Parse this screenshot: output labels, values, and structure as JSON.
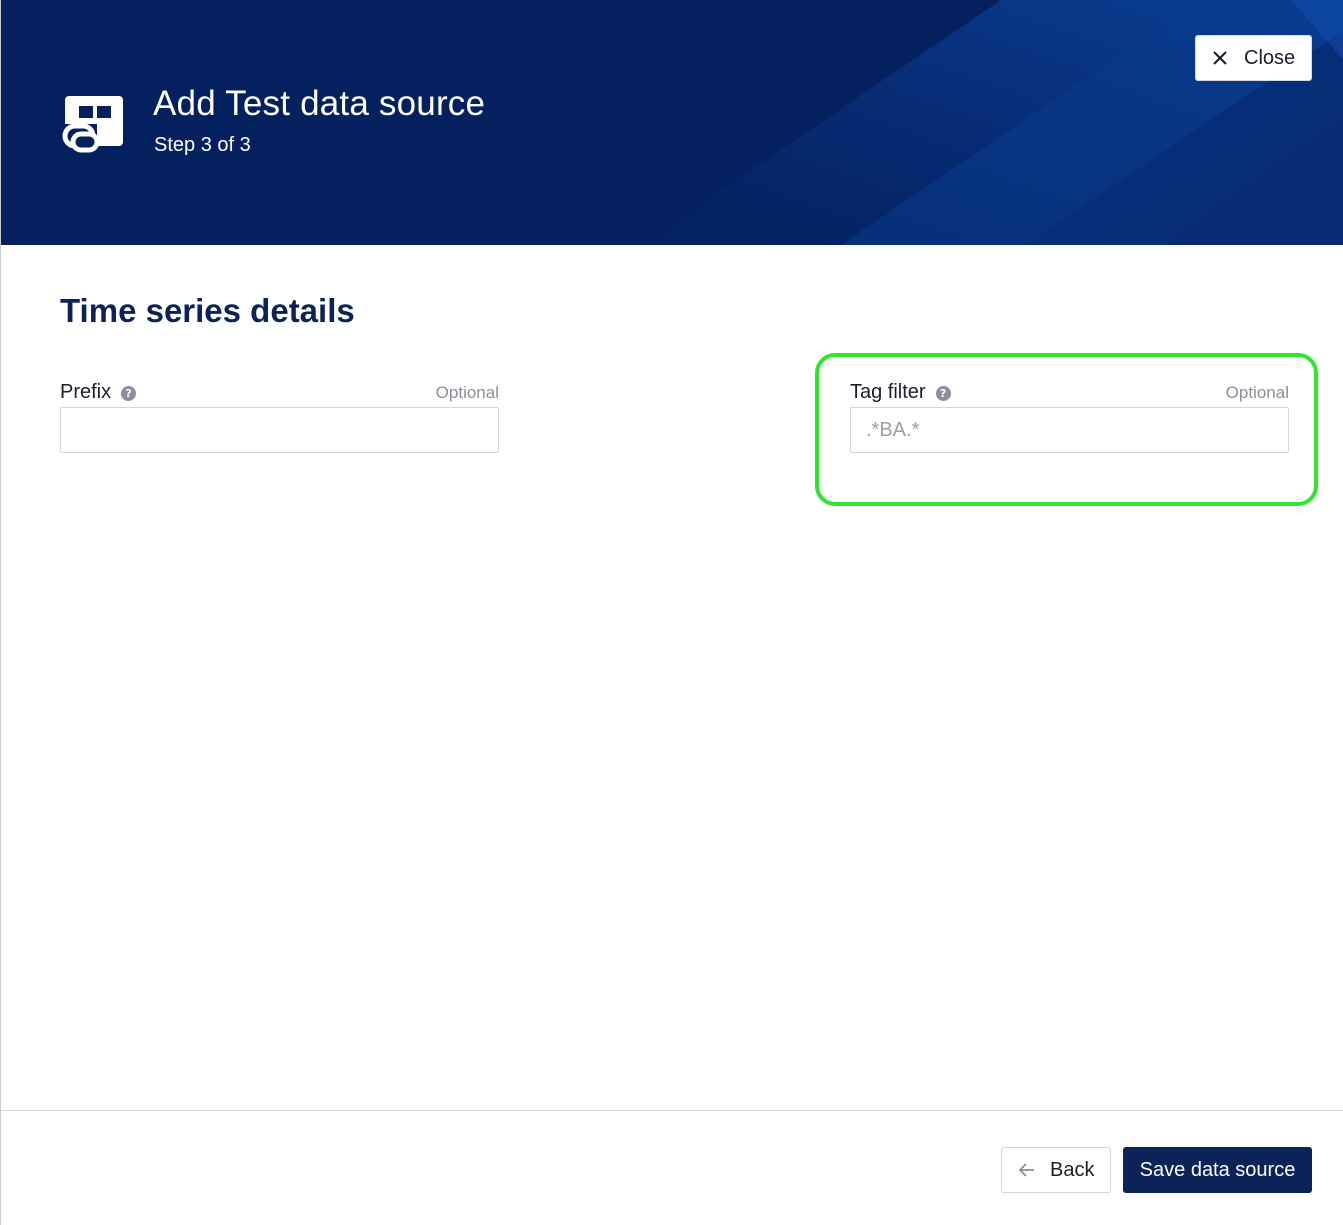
{
  "header": {
    "title": "Add Test data source",
    "step": "Step 3 of 3",
    "icon": "data-source-link-icon",
    "close_label": "Close",
    "background_color": "#04205f"
  },
  "section": {
    "title": "Time series details"
  },
  "fields": {
    "prefix": {
      "label": "Prefix",
      "optional": "Optional",
      "value": "",
      "placeholder": ""
    },
    "tag_filter": {
      "label": "Tag filter",
      "optional": "Optional",
      "value": "",
      "placeholder": ".*BA.*"
    }
  },
  "footer": {
    "back_label": "Back",
    "save_label": "Save data source"
  },
  "colors": {
    "primary": "#0b2358",
    "highlight": "#2ee62e"
  }
}
